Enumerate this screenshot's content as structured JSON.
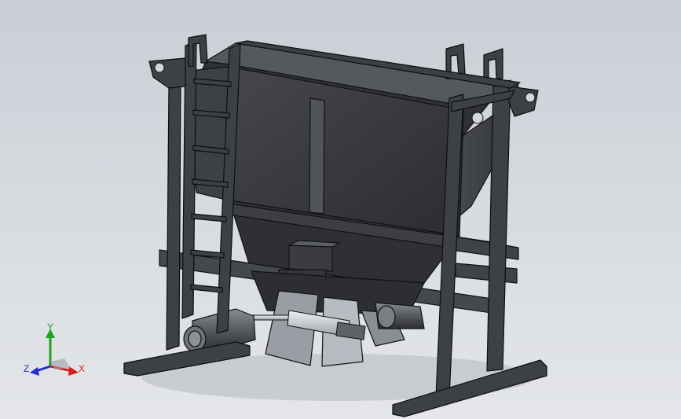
{
  "viewport": {
    "background_top": "#c9ced6",
    "background_bottom": "#e4e6e9",
    "model": {
      "description_icon": "hopper-frame-assembly-icon",
      "body_color": "#3a3c3f",
      "edge_color": "#111111",
      "highlight_color": "#6a6d72",
      "shaft_color": "#c9ccd2"
    }
  },
  "triad": {
    "x_label": "X",
    "y_label": "Y",
    "z_label": "Z",
    "x_color": "#d42020",
    "y_color": "#22a022",
    "z_color": "#2030c8"
  }
}
